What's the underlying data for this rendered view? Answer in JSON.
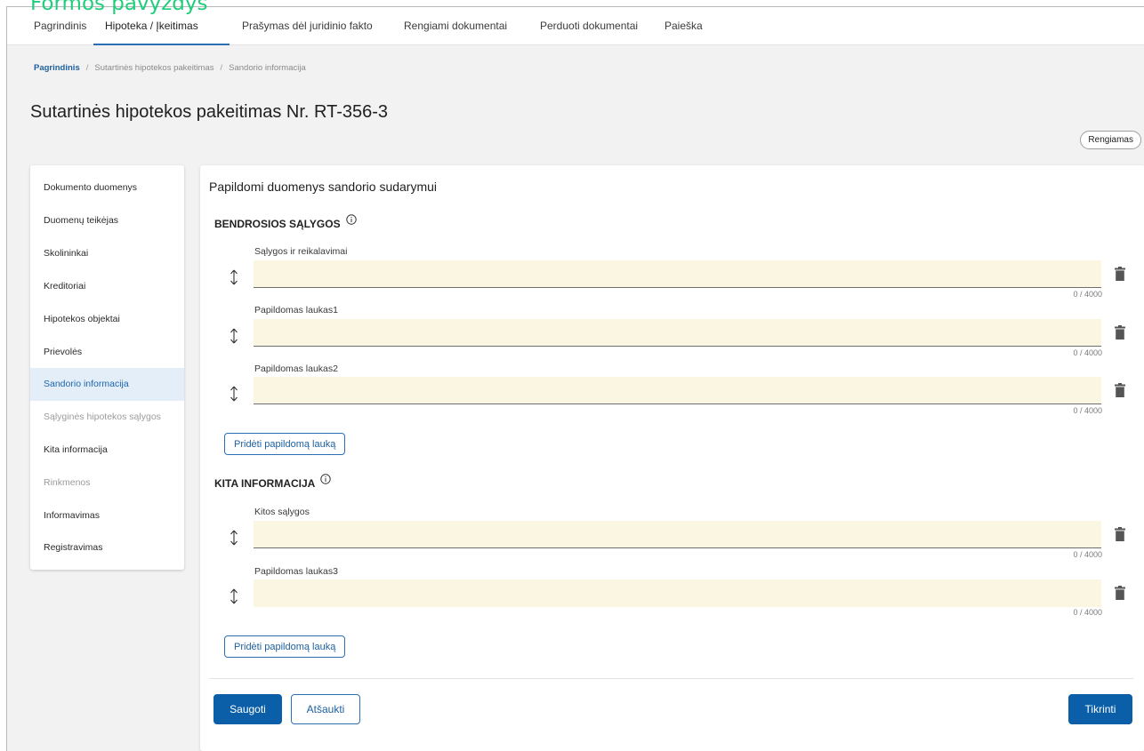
{
  "overlay": {
    "title": "Formos pavyzdys"
  },
  "topnav": {
    "items": [
      {
        "label": "Pagrindinis"
      },
      {
        "label": "Hipoteka / Įkeitimas"
      },
      {
        "label": "Prašymas dėl juridinio fakto"
      },
      {
        "label": "Rengiami dokumentai"
      },
      {
        "label": "Perduoti dokumentai"
      },
      {
        "label": "Paieška"
      }
    ],
    "active_index": 1
  },
  "breadcrumb": {
    "home": "Pagrindinis",
    "separator": "/",
    "level2": "Sutartinės hipotekos pakeitimas",
    "current": "Sandorio informacija"
  },
  "page": {
    "title": "Sutartinės hipotekos pakeitimas Nr. RT-356-3",
    "status": "Rengiamas"
  },
  "sidebar": {
    "items": [
      {
        "label": "Dokumento duomenys",
        "state": "normal"
      },
      {
        "label": "Duomenų teikėjas",
        "state": "normal"
      },
      {
        "label": "Skolininkai",
        "state": "normal"
      },
      {
        "label": "Kreditoriai",
        "state": "normal"
      },
      {
        "label": "Hipotekos objektai",
        "state": "normal"
      },
      {
        "label": "Prievolės",
        "state": "normal"
      },
      {
        "label": "Sandorio informacija",
        "state": "active"
      },
      {
        "label": "Sąlyginės hipotekos sąlygos",
        "state": "disabled"
      },
      {
        "label": "Kita informacija",
        "state": "normal"
      },
      {
        "label": "Rinkmenos",
        "state": "disabled"
      },
      {
        "label": "Informavimas",
        "state": "normal"
      },
      {
        "label": "Registravimas",
        "state": "normal"
      }
    ]
  },
  "main": {
    "title": "Papildomi duomenys sandorio sudarymui",
    "sections": [
      {
        "heading": "BENDROSIOS SĄLYGOS",
        "fields": [
          {
            "label": "Sąlygos ir reikalavimai",
            "value": "",
            "counter": "0 / 4000"
          },
          {
            "label": "Papildomas laukas1",
            "value": "",
            "counter": "0 / 4000"
          },
          {
            "label": "Papildomas laukas2",
            "value": "",
            "counter": "0 / 4000"
          }
        ],
        "add_label": "Pridėti papildomą lauką"
      },
      {
        "heading": "KITA INFORMACIJA",
        "fields": [
          {
            "label": "Kitos sąlygos",
            "value": "",
            "counter": "0 / 4000"
          },
          {
            "label": "Papildomas laukas3",
            "value": "",
            "counter": "0 / 4000"
          }
        ],
        "add_label": "Pridėti papildomą lauką"
      }
    ]
  },
  "actions": {
    "save": "Saugoti",
    "cancel": "Atšaukti",
    "check": "Tikrinti"
  },
  "colors": {
    "accent": "#0a5fa8",
    "field_bg": "#fbf6e2",
    "overlay_title": "#1fce7b",
    "active_sidebar_bg": "#e3eef9"
  }
}
